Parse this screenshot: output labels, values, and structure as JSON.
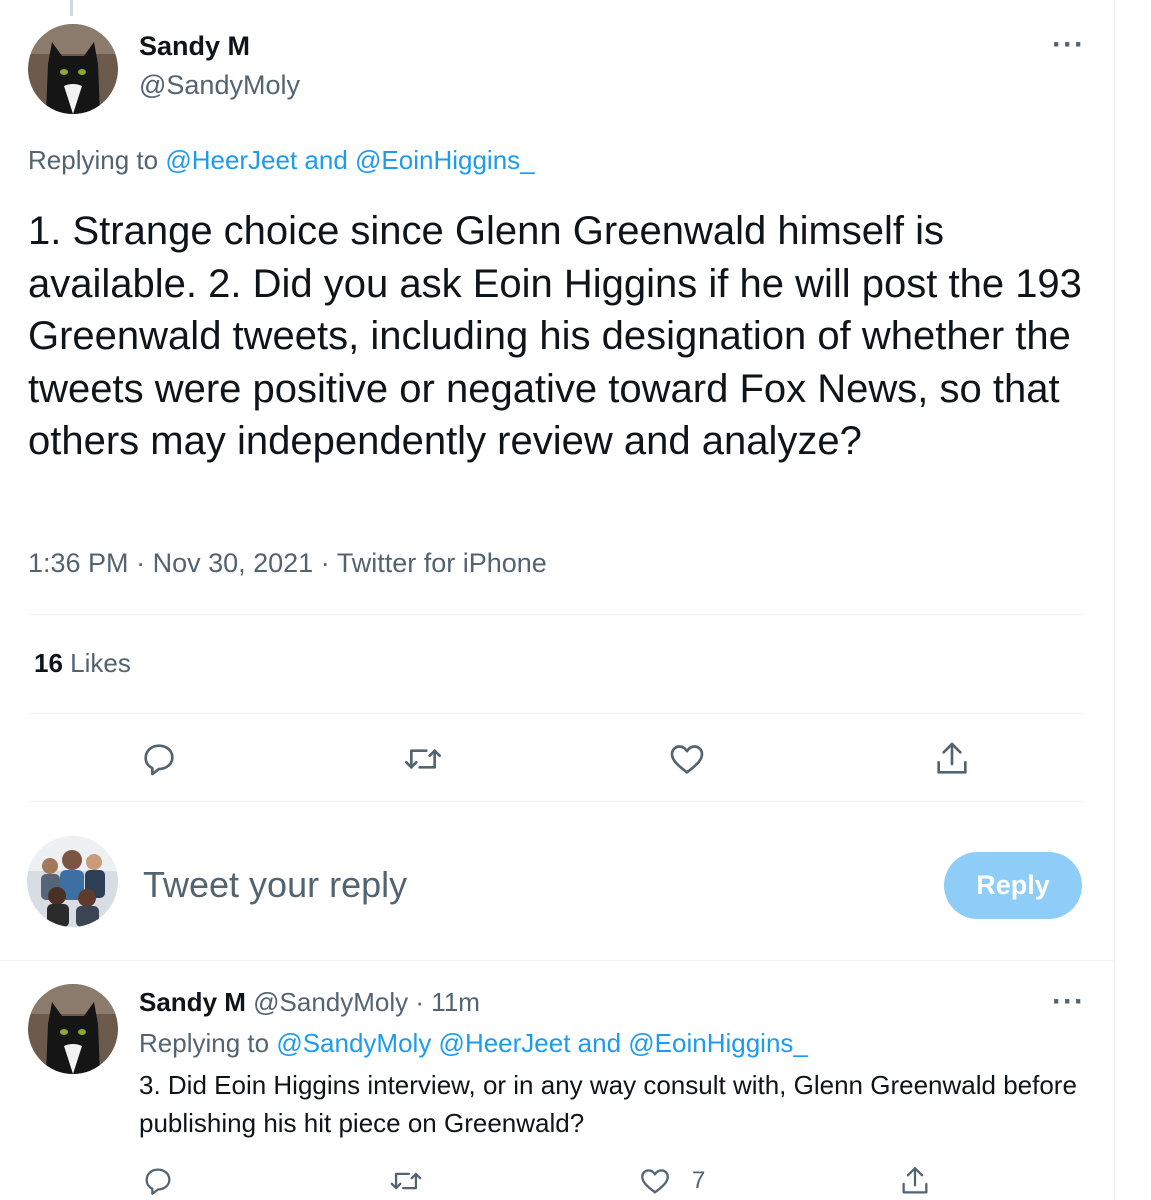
{
  "main_tweet": {
    "author_name": "Sandy M",
    "author_handle": "@SandyMoly",
    "replying_prefix": "Replying to",
    "replying_to": "@HeerJeet and @EoinHiggins_",
    "text": "1. Strange choice since Glenn Greenwald himself is available. 2. Did you ask Eoin Higgins if he will post the 193 Greenwald tweets, including his designation of whether the tweets were positive or negative toward Fox News, so that others may independently review and analyze?",
    "time": "1:36 PM",
    "date": "Nov 30, 2021",
    "source": "Twitter for iPhone",
    "likes_count": "16",
    "likes_label": "Likes",
    "more_icon": "more-icon"
  },
  "actions": {
    "icons": [
      "reply-icon",
      "retweet-icon",
      "like-icon",
      "share-icon"
    ]
  },
  "reply_composer": {
    "placeholder": "Tweet your reply",
    "button_label": "Reply",
    "button_color": "#8ecdf8"
  },
  "reply_tweet": {
    "author_name": "Sandy M",
    "author_handle": "@SandyMoly",
    "elapsed": "11m",
    "replying_prefix": "Replying to",
    "replying_to": "@SandyMoly @HeerJeet and @EoinHiggins_",
    "text": "3. Did Eoin Higgins interview, or in any way consult with, Glenn Greenwald before publishing his hit piece on Greenwald?",
    "like_count": "7"
  },
  "colors": {
    "link": "#1d9bf0",
    "secondary_text": "#536471",
    "primary_text": "#0f1419",
    "divider": "#eff3f4"
  }
}
